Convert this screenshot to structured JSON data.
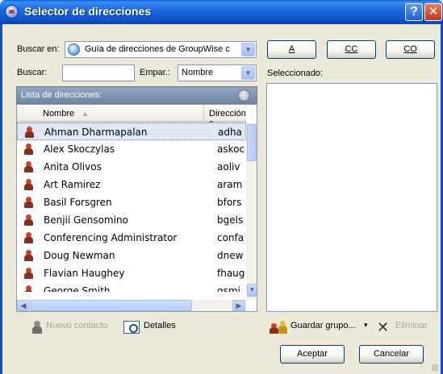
{
  "window": {
    "title": "Selector de direcciones",
    "help_glyph": "?",
    "close_glyph": "✕"
  },
  "search": {
    "buscar_en_label": "Buscar en:",
    "buscar_en_value": "Guía de direcciones de GroupWise c",
    "buscar_label": "Buscar:",
    "buscar_value": "",
    "empar_label": "Empar.:",
    "empar_value": "Nombre"
  },
  "recipient_buttons": {
    "to": "A",
    "cc": "CC",
    "bc": "CO"
  },
  "selected_label": "Seleccionado:",
  "address_list": {
    "header": "Lista de direcciones:",
    "col_name": "Nombre",
    "col_address": "Dirección c",
    "rows": [
      {
        "name": "Ahman Dharmapalan",
        "address": "adha"
      },
      {
        "name": "Alex Skoczylas",
        "address": "askoc"
      },
      {
        "name": "Anita Olivos",
        "address": "aoliv"
      },
      {
        "name": "Art Ramirez",
        "address": "aram"
      },
      {
        "name": "Basil Forsgren",
        "address": "bfors"
      },
      {
        "name": "Benjii Gensomino",
        "address": "bgels"
      },
      {
        "name": "Conferencing Administrator",
        "address": "confa"
      },
      {
        "name": "Doug Newman",
        "address": "dnew"
      },
      {
        "name": "Flavian Haughey",
        "address": "fhaug"
      },
      {
        "name": "George Smith",
        "address": "gsmi"
      }
    ]
  },
  "bottom_left": {
    "new_contact": "Nuevo contacto",
    "details": "Detalles"
  },
  "bottom_right": {
    "save_group": "Guardar grupo...",
    "dropdown_glyph": "▾",
    "remove": "Eliminar"
  },
  "dialog_buttons": {
    "accept": "Aceptar",
    "cancel": "Cancelar"
  },
  "colors": {
    "titlebar": "#0b52c9",
    "dialog_bg": "#ece9d8",
    "list_header": "#6f87a8",
    "selected_row": "#dde7f5"
  },
  "icons": [
    "addressbook-icon",
    "help-icon",
    "close-icon",
    "groupwise-book-icon",
    "refresh-icon",
    "person-icon",
    "new-contact-icon",
    "details-icon",
    "group-icon",
    "delete-icon"
  ]
}
